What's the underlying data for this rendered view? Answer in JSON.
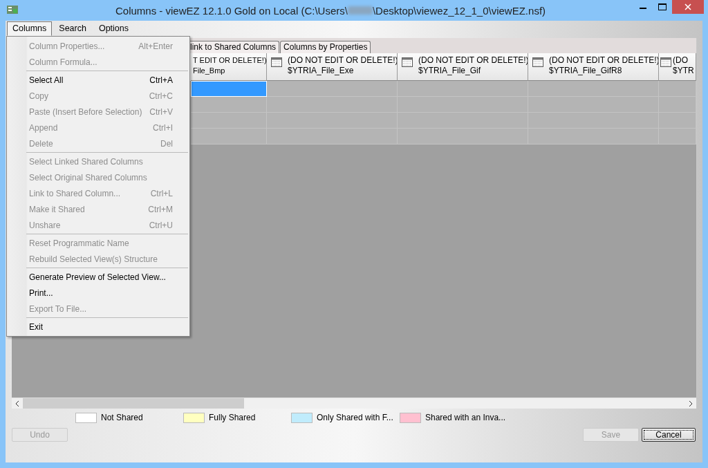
{
  "window": {
    "title_start": "Columns - viewEZ 12.1.0 Gold on Local (C:\\Users\\",
    "title_end": "\\Desktop\\viewez_12_1_0\\viewEZ.nsf)"
  },
  "menubar": [
    {
      "label": "Columns",
      "selected": true
    },
    {
      "label": "Search",
      "selected": false
    },
    {
      "label": "Options",
      "selected": false
    }
  ],
  "menu": {
    "groups": [
      [
        {
          "label": "Column Properties...",
          "shortcut": "Alt+Enter",
          "disabled": true
        },
        {
          "label": "Column Formula...",
          "disabled": true
        }
      ],
      [
        {
          "label": "Select All",
          "shortcut": "Ctrl+A",
          "disabled": false
        },
        {
          "label": "Copy",
          "shortcut": "Ctrl+C",
          "disabled": true
        },
        {
          "label": "Paste (Insert Before Selection)",
          "shortcut": "Ctrl+V",
          "disabled": true
        },
        {
          "label": "Append",
          "shortcut": "Ctrl+I",
          "disabled": true
        },
        {
          "label": "Delete",
          "shortcut": "Del",
          "disabled": true
        }
      ],
      [
        {
          "label": "Select Linked Shared Columns",
          "disabled": true
        },
        {
          "label": "Select Original Shared Columns",
          "disabled": true
        },
        {
          "label": "Link to Shared Column...",
          "shortcut": "Ctrl+L",
          "disabled": true
        },
        {
          "label": "Make it Shared",
          "shortcut": "Ctrl+M",
          "disabled": true
        },
        {
          "label": "Unshare",
          "shortcut": "Ctrl+U",
          "disabled": true
        }
      ],
      [
        {
          "label": "Reset Programmatic Name",
          "disabled": true
        },
        {
          "label": "Rebuild Selected View(s) Structure",
          "disabled": true
        }
      ],
      [
        {
          "label": "Generate Preview of Selected View...",
          "disabled": false
        },
        {
          "label": "Print...",
          "disabled": false
        },
        {
          "label": "Export To File...",
          "disabled": true
        }
      ],
      [
        {
          "label": "Exit",
          "disabled": false
        }
      ]
    ]
  },
  "tabs": [
    {
      "label": "link to Shared Columns",
      "selected": false
    },
    {
      "label": "Columns by Properties",
      "selected": false
    }
  ],
  "grid": {
    "columns": [
      {
        "line1": "T EDIT OR DELETE!)",
        "line2": "File_Bmp",
        "kind": "partial"
      },
      {
        "line1": "(DO NOT EDIT OR DELETE!)",
        "line2": "$YTRIA_File_Exe",
        "kind": "full"
      },
      {
        "line1": "(DO NOT EDIT OR DELETE!)",
        "line2": "$YTRIA_File_Gif",
        "kind": "full"
      },
      {
        "line1": "(DO NOT EDIT OR DELETE!)",
        "line2": "$YTRIA_File_GifR8",
        "kind": "full"
      },
      {
        "line1": "(DO",
        "line2": "$YTR",
        "kind": "edge"
      }
    ],
    "rows": [
      {
        "selected": true
      },
      {
        "selected": false
      },
      {
        "selected": false
      },
      {
        "selected": false
      }
    ]
  },
  "legend": [
    {
      "label": "Not Shared",
      "color": "#ffffff"
    },
    {
      "label": "Fully Shared",
      "color": "#ffffc0"
    },
    {
      "label": "Only Shared with F...",
      "color": "#c0ecfc"
    },
    {
      "label": "Shared with an Inva...",
      "color": "#ffc0d0"
    }
  ],
  "buttons": {
    "undo": {
      "label": "Undo",
      "disabled": true
    },
    "save": {
      "label": "Save",
      "disabled": true
    },
    "cancel": {
      "label": "Cancel",
      "disabled": false
    }
  }
}
